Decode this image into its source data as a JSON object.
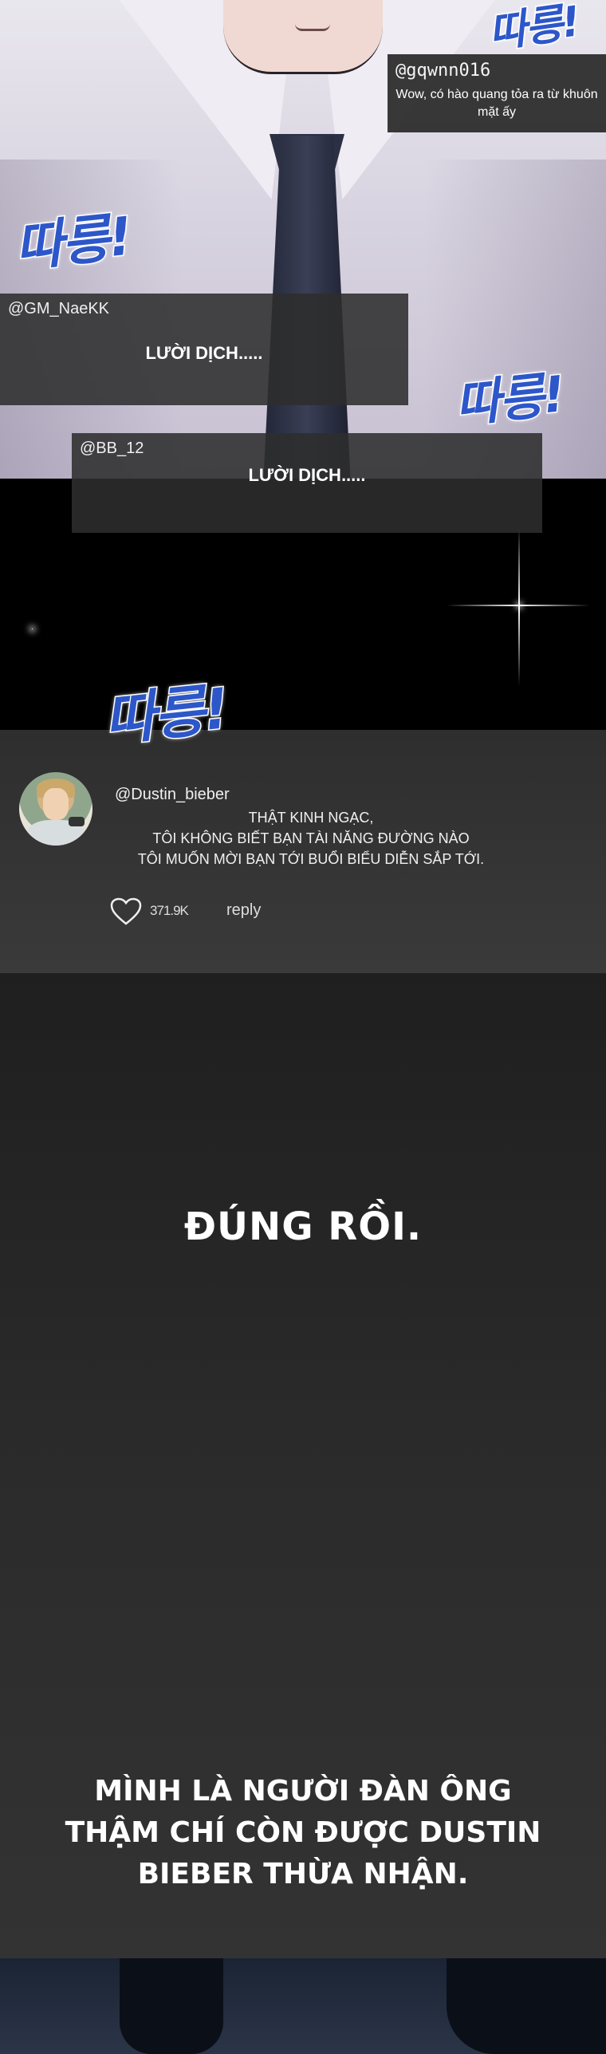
{
  "comments": [
    {
      "user": "@gqwnn016",
      "text": "Wow, có hào quang tỏa ra từ khuôn mặt ấy"
    },
    {
      "user": "@GM_NaeKK",
      "text": "LƯỜI DỊCH....."
    },
    {
      "user": "@BB_12",
      "text": "LƯỜI DỊCH....."
    }
  ],
  "sfx": "따릉!",
  "post": {
    "user": "@Dustin_bieber",
    "lines": [
      "THẬT KINH NGẠC,",
      "TÔI KHÔNG BIẾT BẠN TÀI NĂNG ĐƯỜNG NÀO",
      "TÔI MUỐN MỜI BẠN TỚI BUỔI BIỂU DIỄN SẮP TỚI."
    ],
    "likes": "371.9K",
    "reply_label": "reply",
    "avatar_icon": "avatar-portrait",
    "like_icon": "heart-icon"
  },
  "narration": {
    "line1": "ĐÚNG RỒI.",
    "block": [
      "MÌNH LÀ NGƯỜI ĐÀN ÔNG",
      "THẬM CHÍ CÒN ĐƯỢC DUSTIN",
      "BIEBER THỪA NHẬN."
    ]
  },
  "colors": {
    "sfx": "#2d57c9",
    "comment_bg": "#2d2d2d",
    "text": "#ffffff"
  }
}
